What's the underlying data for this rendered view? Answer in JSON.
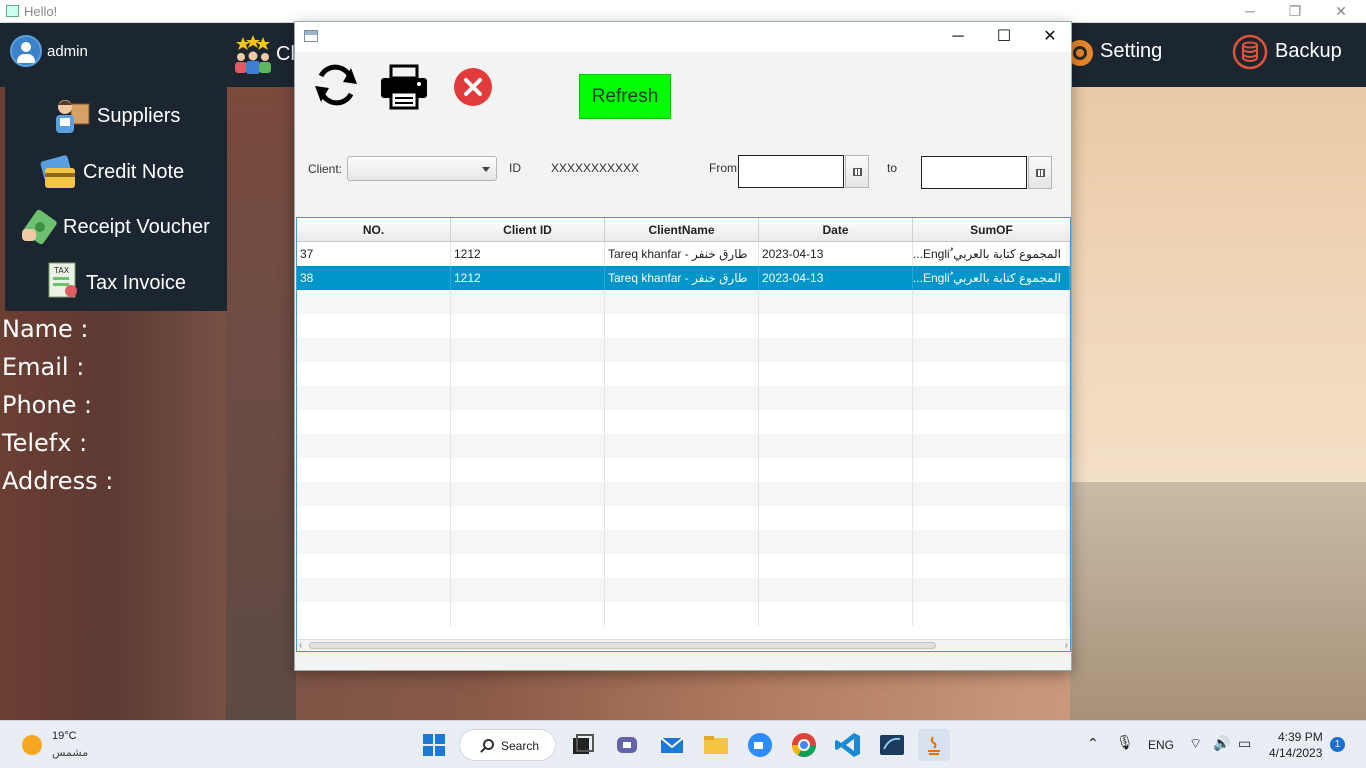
{
  "outer_window": {
    "title": "Hello!"
  },
  "header": {
    "username": "admin",
    "clients_label": "Cl",
    "setting_label": "Setting",
    "backup_label": "Backup"
  },
  "sidebar": {
    "items": [
      {
        "label": "Suppliers",
        "icon": "supplier-icon"
      },
      {
        "label": "Credit Note",
        "icon": "credit-card-icon"
      },
      {
        "label": "Receipt Voucher",
        "icon": "money-icon"
      },
      {
        "label": "Tax Invoice",
        "icon": "tax-invoice-icon"
      }
    ]
  },
  "info_labels": {
    "name": "Name :",
    "email": "Email :",
    "phone": "Phone :",
    "telefx": "Telefx :",
    "address": "Address :"
  },
  "dialog": {
    "refresh_label": "Refresh",
    "filters": {
      "client_label": "Client:",
      "client_value": "",
      "id_label": "ID",
      "id_value": "XXXXXXXXXXX",
      "from_label": "From",
      "from_value": "",
      "to_label": "to",
      "to_value": ""
    },
    "table": {
      "columns": [
        "NO.",
        "Client ID",
        "ClientName",
        "Date",
        "SumOF"
      ],
      "rows": [
        {
          "no": "37",
          "client_id": "1212",
          "client_name": "Tareq khanfar - طارق خنفر",
          "date": "2023-04-13",
          "sum_of": "المجموع كتابة بالعربي ُEngli..."
        },
        {
          "no": "38",
          "client_id": "1212",
          "client_name": "Tareq khanfar - طارق خنفر",
          "date": "2023-04-13",
          "sum_of": "المجموع كتابة بالعربي ُEngli..."
        }
      ],
      "selected_row": 1
    }
  },
  "taskbar": {
    "weather_temp": "19°C",
    "weather_cond": "مشمس",
    "search_label": "Search",
    "language": "ENG",
    "time": "4:39 PM",
    "date": "4/14/2023",
    "notification_count": "1"
  },
  "colors": {
    "header_bg": "#1c2631",
    "refresh_button": "#00ff00",
    "selected_row": "#0096c9",
    "table_border": "#3d9bd5"
  }
}
